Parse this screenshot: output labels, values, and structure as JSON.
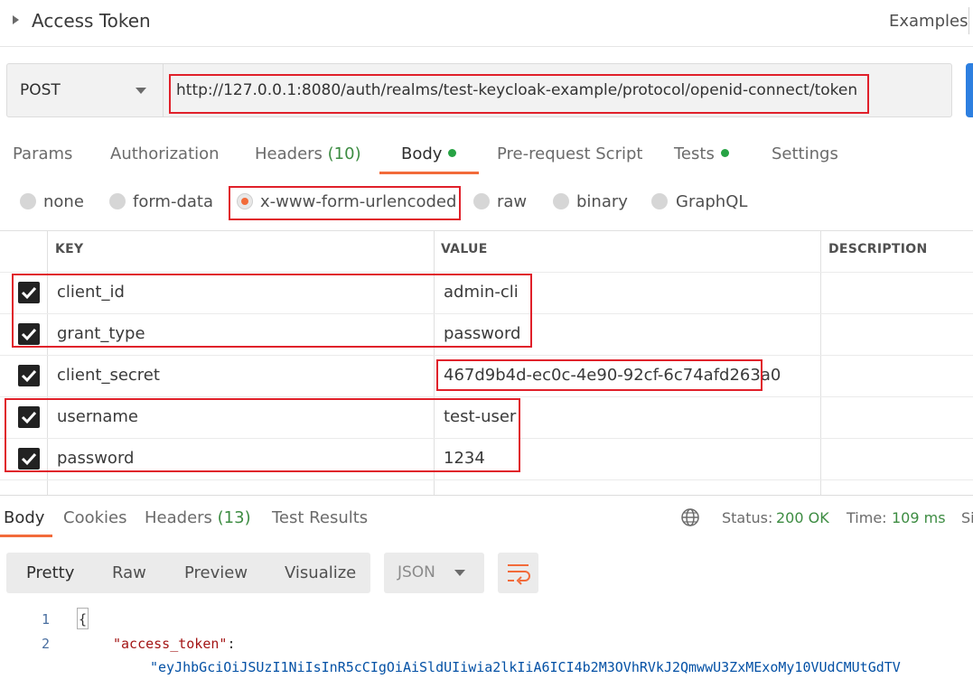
{
  "header": {
    "title": "Access Token",
    "examples_label": "Examples"
  },
  "request": {
    "method": "POST",
    "url": "http://127.0.0.1:8080/auth/realms/test-keycloak-example/protocol/openid-connect/token"
  },
  "tabs": [
    {
      "label": "Params"
    },
    {
      "label": "Authorization"
    },
    {
      "label": "Headers",
      "count": "(10)"
    },
    {
      "label": "Body"
    },
    {
      "label": "Pre-request Script"
    },
    {
      "label": "Tests"
    },
    {
      "label": "Settings"
    }
  ],
  "body_types": [
    "none",
    "form-data",
    "x-www-form-urlencoded",
    "raw",
    "binary",
    "GraphQL"
  ],
  "body_type_selected": "x-www-form-urlencoded",
  "params_table": {
    "columns": [
      "KEY",
      "VALUE",
      "DESCRIPTION"
    ],
    "rows": [
      {
        "key": "client_id",
        "value": "admin-cli",
        "checked": true
      },
      {
        "key": "grant_type",
        "value": "password",
        "checked": true
      },
      {
        "key": "client_secret",
        "value": "467d9b4d-ec0c-4e90-92cf-6c74afd263a0",
        "checked": true
      },
      {
        "key": "username",
        "value": "test-user",
        "checked": true
      },
      {
        "key": "password",
        "value": "1234",
        "checked": true
      }
    ]
  },
  "response": {
    "tabs": [
      {
        "label": "Body"
      },
      {
        "label": "Cookies"
      },
      {
        "label": "Headers",
        "count": "(13)"
      },
      {
        "label": "Test Results"
      }
    ],
    "status_label": "Status:",
    "status": "200 OK",
    "time_label": "Time:",
    "time": "109 ms",
    "size_label_partial": "Si",
    "views": [
      "Pretty",
      "Raw",
      "Preview",
      "Visualize"
    ],
    "format": "JSON",
    "lines": [
      {
        "num": "1",
        "text": "{"
      },
      {
        "num": "2",
        "key": "\"access_token\"",
        "colon": ":"
      }
    ],
    "token_fragment": "\"eyJhbGciOiJSUzI1NiIsInR5cCIgOiAiSldUIiwia2lkIiA6ICI4b2M3OVhRVkJ2QmwwU3ZxMExoMy10VUdCMUtGdTV"
  },
  "colors": {
    "accent": "#f26b3a",
    "success": "#27a344",
    "highlight": "#e0202a",
    "send": "#2d7fe0"
  }
}
